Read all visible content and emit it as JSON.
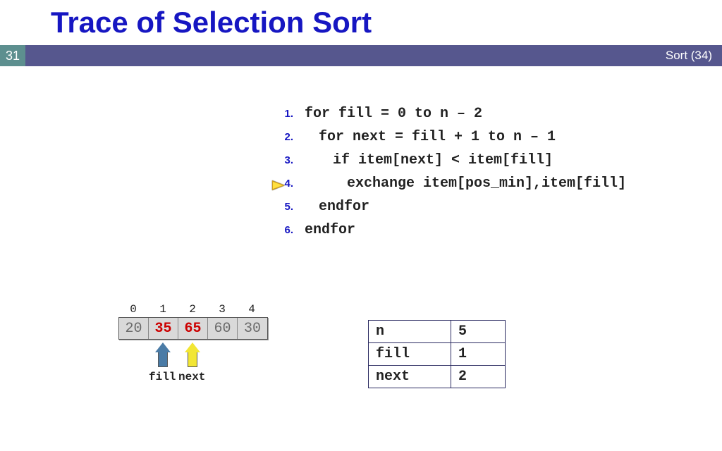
{
  "title": "Trace of Selection Sort",
  "bar": {
    "page": "31",
    "right": "Sort (34)"
  },
  "code": {
    "lines": [
      {
        "n": "1.",
        "indent": 0,
        "text": "for fill = 0 to n – 2"
      },
      {
        "n": "2.",
        "indent": 1,
        "text": "for next = fill + 1 to n – 1"
      },
      {
        "n": "3.",
        "indent": 2,
        "text": "if item[next] < item[fill]"
      },
      {
        "n": "4.",
        "indent": 3,
        "text": "exchange item[pos_min],item[fill]"
      },
      {
        "n": "5.",
        "indent": 1,
        "text": "endfor"
      },
      {
        "n": "6.",
        "indent": 0,
        "text": "endfor"
      }
    ],
    "current_line_index": 3
  },
  "array": {
    "indices": [
      "0",
      "1",
      "2",
      "3",
      "4"
    ],
    "cells": [
      {
        "v": "20",
        "hl": false
      },
      {
        "v": "35",
        "hl": true
      },
      {
        "v": "65",
        "hl": true
      },
      {
        "v": "60",
        "hl": false
      },
      {
        "v": "30",
        "hl": false
      }
    ],
    "pointers": {
      "fill": {
        "label": "fill",
        "index": 1,
        "color": "blue"
      },
      "next": {
        "label": "next",
        "index": 2,
        "color": "yellow"
      }
    }
  },
  "vars": [
    {
      "k": "n",
      "v": "5"
    },
    {
      "k": "fill",
      "v": "1"
    },
    {
      "k": "next",
      "v": "2"
    }
  ]
}
